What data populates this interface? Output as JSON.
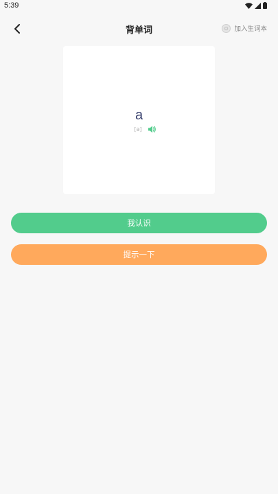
{
  "status_bar": {
    "time": "5:39"
  },
  "header": {
    "title": "背单词",
    "add_vocab_label": "加入生词本"
  },
  "card": {
    "word": "a",
    "phonetic": "[ə]"
  },
  "buttons": {
    "know_label": "我认识",
    "hint_label": "提示一下"
  },
  "colors": {
    "accent_green": "#52cc8c",
    "accent_orange": "#ffa95c",
    "word_color": "#3c4470"
  },
  "icons": {
    "back": "chevron-left-icon",
    "add_vocab": "circle-icon",
    "speaker": "speaker-icon",
    "wifi": "wifi-icon",
    "signal": "signal-icon",
    "battery": "battery-icon"
  }
}
